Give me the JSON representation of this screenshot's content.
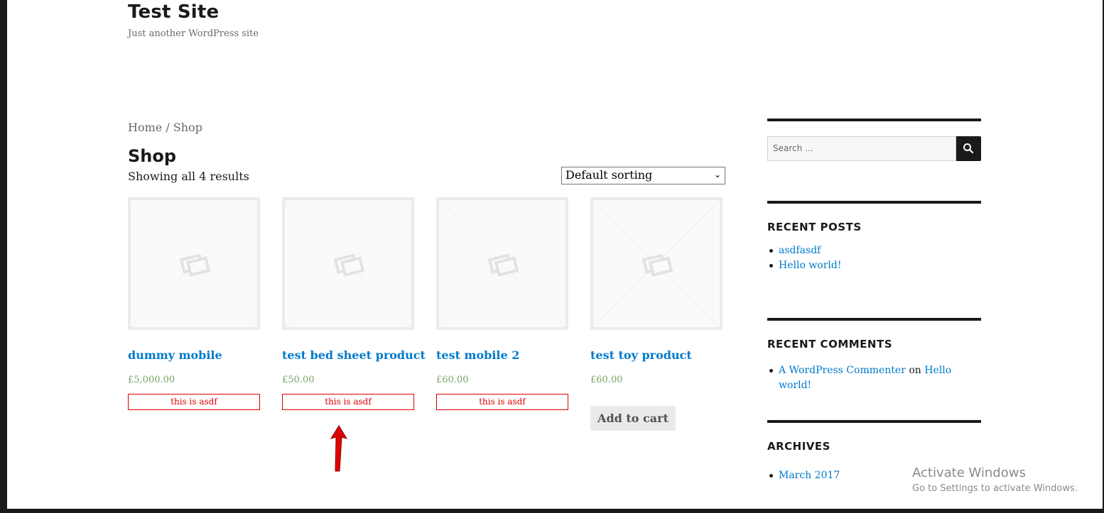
{
  "site": {
    "title": "Test Site",
    "description": "Just another WordPress site"
  },
  "breadcrumb": "Home / Shop",
  "shop": {
    "title": "Shop",
    "result_count": "Showing all 4 results",
    "sorting": "Default sorting"
  },
  "products": [
    {
      "title": "dummy mobile",
      "price": "£5,000.00",
      "note": "this is asdf"
    },
    {
      "title": "test bed sheet product",
      "price": "£50.00",
      "note": "this is asdf"
    },
    {
      "title": "test mobile 2",
      "price": "£60.00",
      "note": "this is asdf"
    },
    {
      "title": "test toy product",
      "price": "£60.00",
      "button": "Add to cart"
    }
  ],
  "sidebar": {
    "search_placeholder": "Search …",
    "recent_posts": {
      "title": "RECENT POSTS",
      "items": [
        "asdfasdf",
        "Hello world!"
      ]
    },
    "recent_comments": {
      "title": "RECENT COMMENTS",
      "author": "A WordPress Commenter",
      "on": "on",
      "post": "Hello world!"
    },
    "archives": {
      "title": "ARCHIVES",
      "items": [
        "March 2017"
      ]
    }
  },
  "watermark": {
    "line1": "Activate Windows",
    "line2": "Go to Settings to activate Windows."
  },
  "colors": {
    "link": "#007acc",
    "price": "#77a464",
    "note": "#e00000",
    "arrow": "#e00000"
  },
  "icons": [
    "placeholder-image-icon",
    "search-icon",
    "chevron-down-icon",
    "red-arrow-icon"
  ]
}
